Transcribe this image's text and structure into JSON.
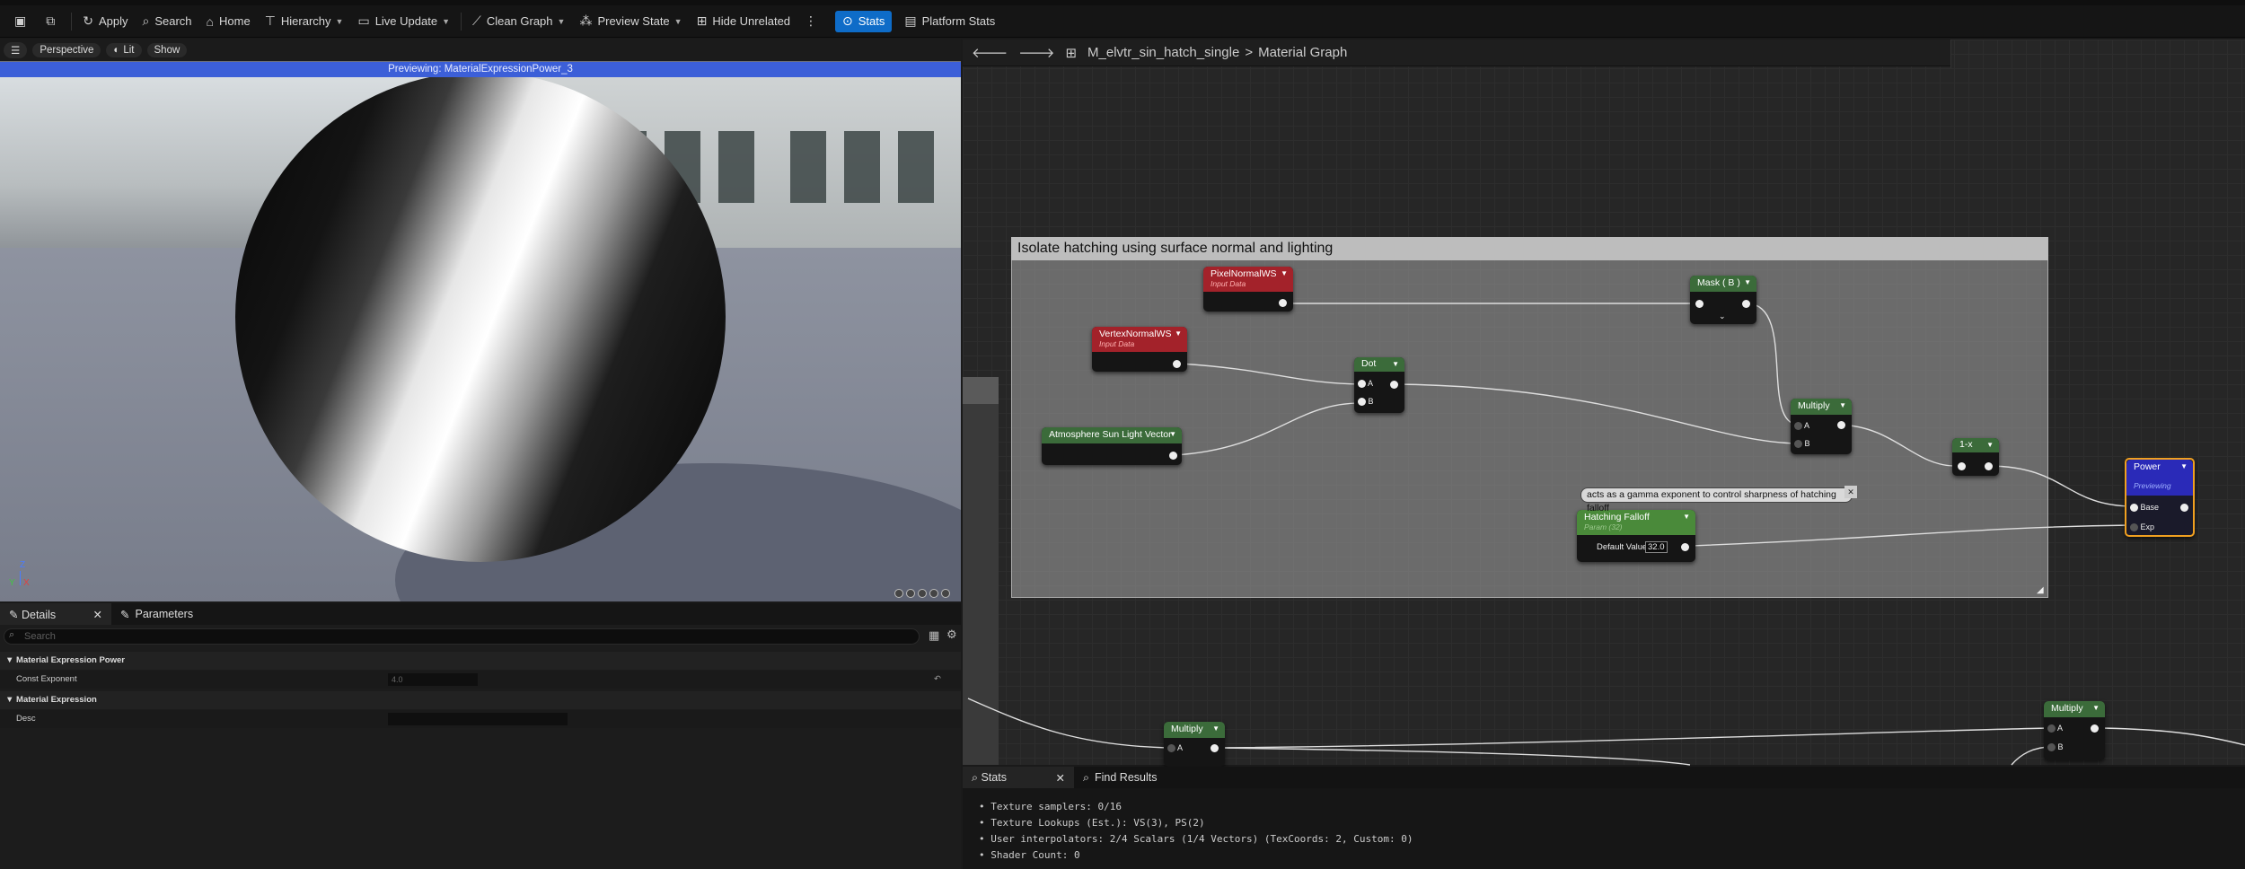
{
  "toolbar": {
    "apply": "Apply",
    "search": "Search",
    "home": "Home",
    "hierarchy": "Hierarchy",
    "live_update": "Live Update",
    "clean_graph": "Clean Graph",
    "preview_state": "Preview State",
    "hide_unrelated": "Hide Unrelated",
    "stats": "Stats",
    "platform_stats": "Platform Stats"
  },
  "viewport": {
    "perspective": "Perspective",
    "lit": "Lit",
    "show": "Show",
    "previewing": "Previewing: MaterialExpressionPower_3",
    "gizmo_z": "Z",
    "gizmo_x": "X",
    "gizmo_y": "Y"
  },
  "details": {
    "tab_details": "Details",
    "tab_parameters": "Parameters",
    "search_placeholder": "Search",
    "sections": [
      "Material Expression Power",
      "Material Expression"
    ],
    "const_exponent_label": "Const Exponent",
    "const_exponent_value": "4.0",
    "desc_label": "Desc",
    "desc_value": ""
  },
  "graph": {
    "breadcrumb_asset": "M_elvtr_sin_hatch_single",
    "breadcrumb_sep": ">",
    "breadcrumb_graph": "Material Graph",
    "comment_title": "Isolate hatching using surface normal and lighting",
    "nodes": {
      "pixelnormal": {
        "title": "PixelNormalWS",
        "sub": "Input Data"
      },
      "vertexnormal": {
        "title": "VertexNormalWS",
        "sub": "Input Data"
      },
      "dot": {
        "title": "Dot",
        "pin_a": "A",
        "pin_b": "B"
      },
      "sunlight": {
        "title": "Atmosphere Sun Light Vector"
      },
      "mask": {
        "title": "Mask ( B )"
      },
      "multiply1": {
        "title": "Multiply",
        "pin_a": "A",
        "pin_b": "B"
      },
      "oneminus": {
        "title": "1-x"
      },
      "power": {
        "title": "Power",
        "sub": "Previewing",
        "pin_base": "Base",
        "pin_exp": "Exp"
      },
      "hatching": {
        "title": "Hatching Falloff",
        "sub": "Param (32)",
        "default_label": "Default Value",
        "default_value": "32.0"
      },
      "multiply2": {
        "title": "Multiply",
        "pin_a": "A"
      },
      "multiply3": {
        "title": "Multiply",
        "pin_a": "A",
        "pin_b": "B"
      }
    },
    "tooltip": "acts as a gamma exponent to control sharpness of hatching falloff"
  },
  "stats": {
    "tab_stats": "Stats",
    "tab_find": "Find Results",
    "lines": [
      "Texture samplers: 0/16",
      "Texture Lookups (Est.): VS(3), PS(2)",
      "User interpolators: 2/4 Scalars (1/4 Vectors) (TexCoords: 2, Custom: 0)",
      "Shader Count: 0"
    ]
  },
  "colors": {
    "accent": "#0e6cc8",
    "preview_bar": "#3c5fd8",
    "input_node": "#a3222a",
    "green_node": "#3b6b3a",
    "power_node": "#2a2ab8",
    "power_border": "#f0a020"
  }
}
